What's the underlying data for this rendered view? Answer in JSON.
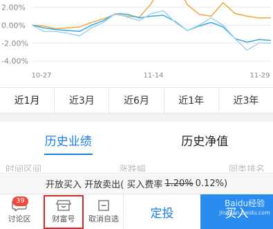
{
  "chart_data": {
    "type": "line",
    "y_ticks": [
      "2.00%",
      "0.00%",
      "-2.00%",
      "-4.00%"
    ],
    "y_values": [
      2,
      0,
      -2,
      -4
    ],
    "ylim": [
      -4.6,
      2.8
    ],
    "x_ticks": [
      "10-27",
      "11-14",
      "11-29"
    ],
    "grid": true,
    "series": [
      {
        "color": "#f0a637",
        "values": [
          0.0,
          -0.1,
          -0.4,
          -0.3,
          -0.2,
          0.3,
          0.7,
          1.2,
          1.0,
          0.9,
          2.4,
          5.0,
          4.8,
          2.3,
          1.2,
          1.0,
          2.5,
          1.3,
          1.0,
          0.8,
          0.8
        ]
      },
      {
        "color": "#35a8ea",
        "values": [
          0.0,
          -0.3,
          -0.5,
          -0.6,
          -0.7,
          0.0,
          0.5,
          1.3,
          1.2,
          0.8,
          1.0,
          1.1,
          0.4,
          -0.6,
          -0.1,
          0.3,
          -0.2,
          -1.5,
          -1.9,
          -1.6,
          -1.7
        ]
      },
      {
        "color": "#9fd2f2",
        "values": [
          0.0,
          -0.7,
          -0.7,
          -0.9,
          -1.2,
          -0.3,
          0.3,
          1.3,
          0.9,
          0.5,
          1.3,
          1.6,
          0.3,
          -0.6,
          0.0,
          0.8,
          0.0,
          -1.5,
          -2.8,
          -2.0,
          -2.0
        ]
      }
    ]
  },
  "periods": [
    {
      "label": "近1月",
      "active": true
    },
    {
      "label": "近3月",
      "active": false
    },
    {
      "label": "近6月",
      "active": false
    },
    {
      "label": "近1年",
      "active": false
    },
    {
      "label": "近3年",
      "active": false
    }
  ],
  "section_tabs": [
    {
      "label": "历史业绩",
      "active": true
    },
    {
      "label": "历史净值",
      "active": false
    }
  ],
  "table_columns": [
    "时间区间",
    "涨跌幅",
    "同类排名"
  ],
  "trade_info": {
    "prefix": "开放买入 开放卖出( 买入费率",
    "old_rate": "1.20%",
    "new_rate": "0.12%)"
  },
  "bottom_bar": {
    "discussion_label": "讨论区",
    "discussion_badge": "39",
    "wealth_label": "财富号",
    "unwatch_label": "取消自选",
    "dingtou_label": "定投",
    "buy_label": "买入",
    "watermark_line1": "Baidu经验",
    "watermark_line2": "jingyan.baidu.com"
  }
}
